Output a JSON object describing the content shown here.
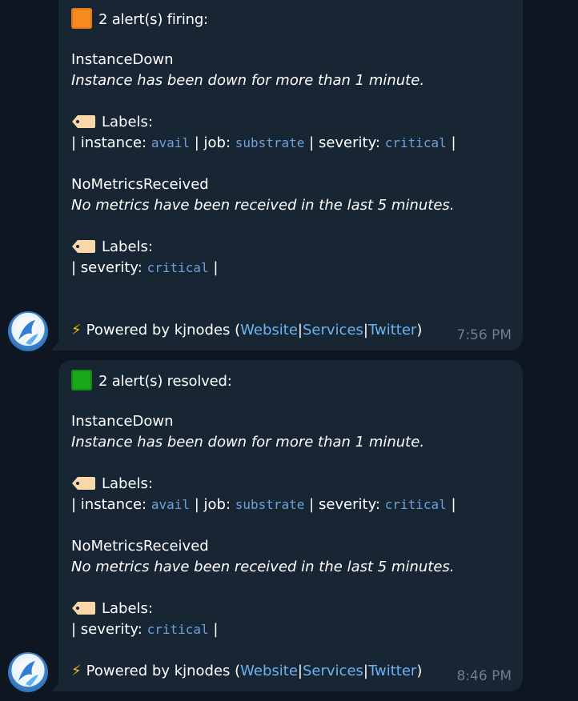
{
  "messages": [
    {
      "header": "2 alert(s) firing:",
      "status_color": "#f58b1f",
      "alerts": [
        {
          "name": "InstanceDown",
          "description": "Instance has been down for more than 1 minute.",
          "labels_title": "Labels:",
          "label_line": {
            "p1": "| instance: ",
            "v1": "avail",
            "p2": " | job: ",
            "v2": "substrate",
            "p3": " | severity: ",
            "v3": "critical",
            "p4": " |"
          }
        },
        {
          "name": "NoMetricsReceived",
          "description": "No metrics have been received in the last 5 minutes.",
          "labels_title": "Labels:",
          "label_line": {
            "p1": "| severity: ",
            "v1": "critical",
            "p2": " |"
          }
        }
      ],
      "footer": {
        "prefix": "Powered by kjnodes (",
        "website": "Website",
        "sep1": "|",
        "services": "Services",
        "sep2": "|",
        "twitter": "Twitter",
        "suffix": ")"
      },
      "time": "7:56 PM"
    },
    {
      "header": "2 alert(s) resolved:",
      "status_color": "#1aa81a",
      "alerts": [
        {
          "name": "InstanceDown",
          "description": "Instance has been down for more than 1 minute.",
          "labels_title": "Labels:",
          "label_line": {
            "p1": "| instance: ",
            "v1": "avail",
            "p2": " | job: ",
            "v2": "substrate",
            "p3": " | severity: ",
            "v3": "critical",
            "p4": " |"
          }
        },
        {
          "name": "NoMetricsReceived",
          "description": "No metrics have been received in the last 5 minutes.",
          "labels_title": "Labels:",
          "label_line": {
            "p1": "| severity: ",
            "v1": "critical",
            "p2": " |"
          }
        }
      ],
      "footer": {
        "prefix": "Powered by kjnodes (",
        "website": "Website",
        "sep1": "|",
        "services": "Services",
        "sep2": "|",
        "twitter": "Twitter",
        "suffix": ")"
      },
      "time": "8:46 PM"
    }
  ]
}
